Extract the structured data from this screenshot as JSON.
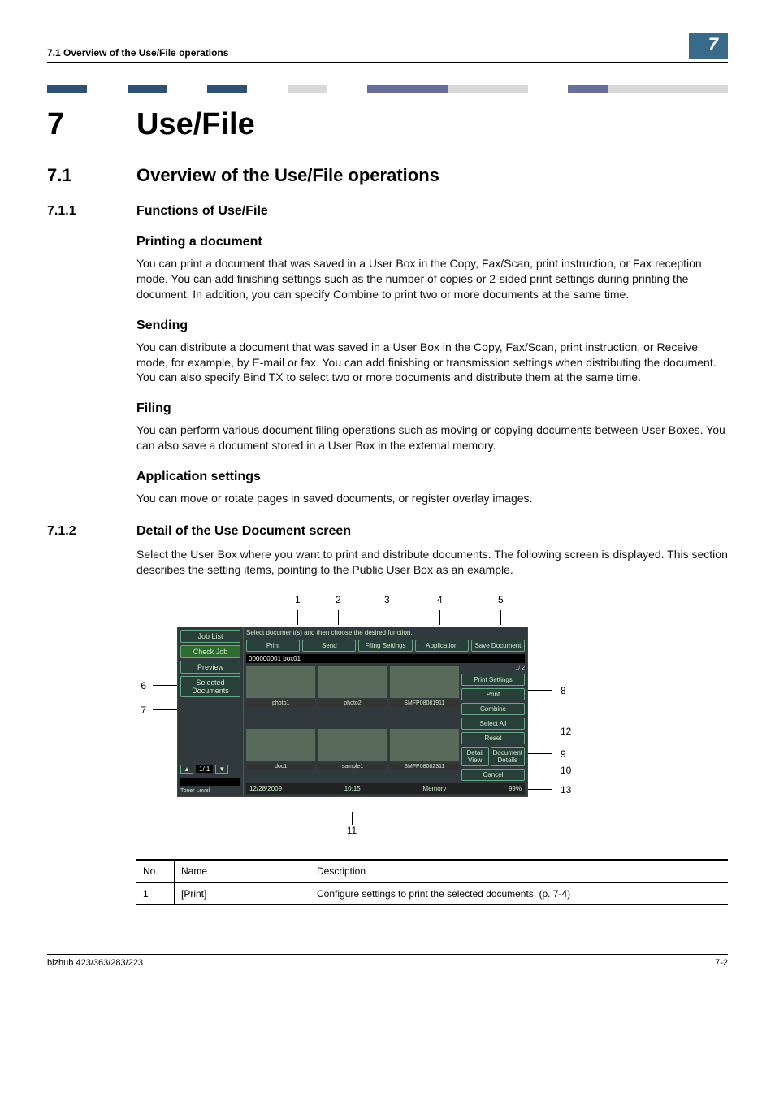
{
  "header": {
    "left": "7.1    Overview of the Use/File operations",
    "right": "7"
  },
  "bar_colors": [
    "#2f4f75",
    "#ffffff",
    "#2f4f75",
    "#ffffff",
    "#2f4f75",
    "#ffffff",
    "#d9d9d9",
    "#ffffff",
    "#6a6f9a",
    "#6a6f9a",
    "#d9d9d9",
    "#d9d9d9",
    "#ffffff",
    "#6a6f9a",
    "#d9d9d9",
    "#d9d9d9",
    "#d9d9d9"
  ],
  "chapter": {
    "num": "7",
    "title": "Use/File"
  },
  "s71": {
    "num": "7.1",
    "title": "Overview of the Use/File operations"
  },
  "s711": {
    "num": "7.1.1",
    "title": "Functions of Use/File"
  },
  "printing": {
    "h": "Printing a document",
    "p": "You can print a document that was saved in a User Box in the Copy, Fax/Scan, print instruction, or Fax reception mode. You can add finishing settings such as the number of copies or 2-sided print settings during printing the document. In addition, you can specify Combine to print two or more documents at the same time."
  },
  "sending": {
    "h": "Sending",
    "p": "You can distribute a document that was saved in a User Box in the Copy, Fax/Scan, print instruction, or Receive mode, for example, by E-mail or fax. You can add finishing or transmission settings when distributing the document. You can also specify Bind TX to select two or more documents and distribute them at the same time."
  },
  "filing": {
    "h": "Filing",
    "p": "You can perform various document filing operations such as moving or copying documents between User Boxes. You can also save a document stored in a User Box in the external memory."
  },
  "app": {
    "h": "Application settings",
    "p": "You can move or rotate pages in saved documents, or register overlay images."
  },
  "s712": {
    "num": "7.1.2",
    "title": "Detail of the Use Document screen",
    "p": "Select the User Box where you want to print and distribute documents. The following screen is displayed. This section describes the setting items, pointing to the Public User Box as an example."
  },
  "callouts": {
    "c1": "1",
    "c2": "2",
    "c3": "3",
    "c4": "4",
    "c5": "5",
    "c6": "6",
    "c7": "7",
    "c8": "8",
    "c9": "9",
    "c10": "10",
    "c11": "11",
    "c12": "12",
    "c13": "13"
  },
  "screen": {
    "left": {
      "joblist": "Job List",
      "checkjob": "Check Job",
      "preview": "Preview",
      "seldocs": "Selected Documents",
      "toner": "Toner Level"
    },
    "msg": "Select document(s) and then\nchoose the desired function.",
    "tabs": {
      "print": "Print",
      "send": "Send",
      "filing": "Filing Settings",
      "application": "Application",
      "savedoc": "Save Document"
    },
    "boxline": "000000001  box01",
    "thumbs": [
      "photo1",
      "photo2",
      "SMFP08081911",
      "doc1",
      "sample1",
      "SMFP08082311"
    ],
    "side": {
      "printsettings": "Print Settings",
      "print": "Print",
      "combine": "Combine",
      "selectall": "Select All",
      "reset": "Reset",
      "detail": "Detail View",
      "docdetails": "Document Details",
      "cancel": "Cancel"
    },
    "pager": {
      "top": "1/ 2",
      "bottom": "1/ 1"
    },
    "footer": {
      "date": "12/28/2009",
      "time": "10:15",
      "mem": "Memory",
      "mempct": "99%"
    }
  },
  "table": {
    "head": {
      "no": "No.",
      "name": "Name",
      "desc": "Description"
    },
    "rows": [
      {
        "no": "1",
        "name": "[Print]",
        "desc": "Configure settings to print the selected documents. (p. 7-4)"
      }
    ]
  },
  "footer": {
    "left": "bizhub 423/363/283/223",
    "right": "7-2"
  }
}
